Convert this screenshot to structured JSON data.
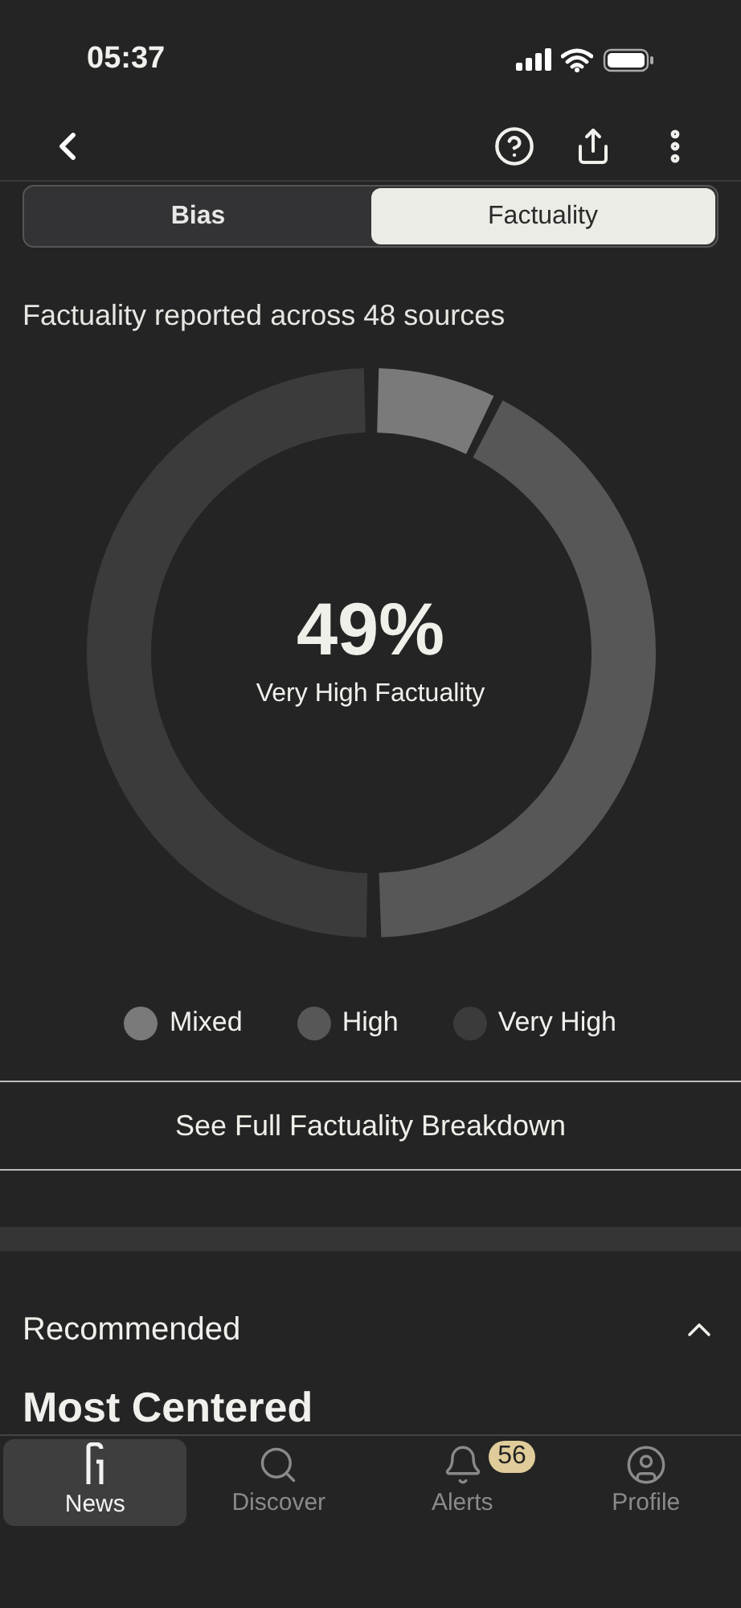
{
  "status_bar": {
    "time": "05:37"
  },
  "segments": [
    {
      "label": "Bias",
      "selected": false
    },
    {
      "label": "Factuality",
      "selected": true
    }
  ],
  "summary": "Factuality reported across 48 sources",
  "donut": {
    "value": "49%",
    "caption": "Very High Factuality"
  },
  "legend": [
    {
      "label": "Mixed",
      "color": "#7a7a7a"
    },
    {
      "label": "High",
      "color": "#575757"
    },
    {
      "label": "Very High",
      "color": "#3b3b3b"
    }
  ],
  "breakdown_button": "See Full Factuality Breakdown",
  "recommended": {
    "title": "Recommended",
    "expanded": true,
    "subtitle": "Most Centered"
  },
  "tab_bar": [
    {
      "kind": "news",
      "label": "News",
      "selected": true
    },
    {
      "kind": "discover",
      "label": "Discover",
      "selected": false
    },
    {
      "kind": "alerts",
      "label": "Alerts",
      "selected": false,
      "badge": "56"
    },
    {
      "kind": "profile",
      "label": "Profile",
      "selected": false
    }
  ]
}
